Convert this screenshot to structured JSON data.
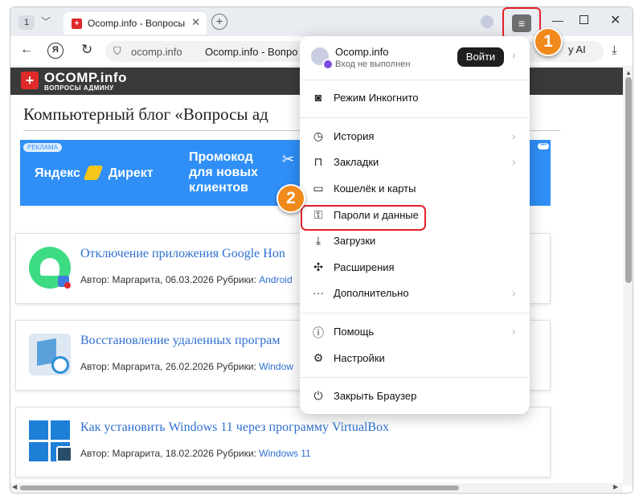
{
  "browser": {
    "tab_count": "1",
    "tab_title": "Ocomp.info - Вопросы а",
    "address_domain": "ocomp.info",
    "address_title": "Ocomp.info - Вопро",
    "ai_label": "y AI"
  },
  "site": {
    "logo_name": "OCOMP.info",
    "logo_sub": "ВОПРОСЫ АДМИНУ",
    "blog_title": "Компьютерный блог «Вопросы ад",
    "ad": {
      "tag": "РЕКЛАМА",
      "brand": "Яндекс",
      "brand2": "Директ",
      "promo": "Промокод для новых клиентов"
    },
    "posts": [
      {
        "title": "Отключение приложения Google Hon",
        "meta": "Автор: Маргарита, 06.03.2026 Рубрики: ",
        "category": "Android"
      },
      {
        "title": "Восстановление удаленных програм",
        "meta": "Автор: Маргарита, 26.02.2026 Рубрики: ",
        "category": "Window"
      },
      {
        "title": "Как установить Windows 11 через программу VirtualBox",
        "meta": "Автор: Маргарита, 18.02.2026 Рубрики: ",
        "category": "Windows 11"
      }
    ]
  },
  "menu": {
    "account_name": "Ocomp.info",
    "account_status": "Вход не выполнен",
    "login_label": "Войти",
    "items": [
      {
        "label": "Режим Инкогнито",
        "icon": "incognito-icon"
      },
      {
        "label": "История",
        "icon": "history-icon"
      },
      {
        "label": "Закладки",
        "icon": "bookmarks-icon"
      },
      {
        "label": "Кошелёк и карты",
        "icon": "wallet-icon"
      },
      {
        "label": "Пароли и данные",
        "icon": "passwords-icon"
      },
      {
        "label": "Загрузки",
        "icon": "downloads-icon"
      },
      {
        "label": "Расширения",
        "icon": "extensions-icon"
      },
      {
        "label": "Дополнительно",
        "icon": "more-icon"
      },
      {
        "label": "Помощь",
        "icon": "help-icon"
      },
      {
        "label": "Настройки",
        "icon": "settings-icon"
      },
      {
        "label": "Закрыть Браузер",
        "icon": "power-icon"
      }
    ]
  },
  "annotations": {
    "step1": "1",
    "step2": "2"
  },
  "colors": {
    "highlight": "#e5202a",
    "badge": "#f08a1d",
    "link": "#2e6fd0",
    "ad_bg": "#2f8ff6"
  }
}
